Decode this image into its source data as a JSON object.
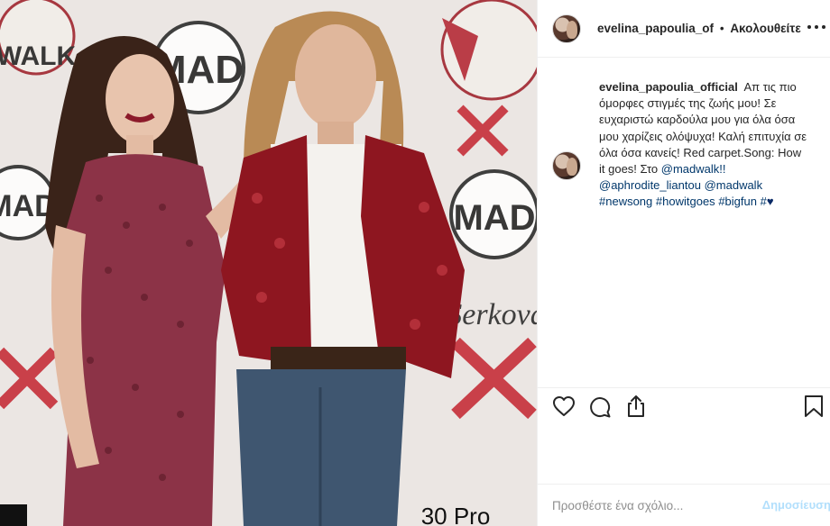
{
  "post": {
    "photo_signs": [
      "MAD",
      "WALK",
      "MAD",
      "MAD",
      "Serkova",
      "30 Pro"
    ]
  },
  "header": {
    "username": "evelina_papoulia_of",
    "separator": "•",
    "follow_label": "Ακολουθείτε",
    "more_icon": "more-horizontal-icon"
  },
  "caption": {
    "username": "evelina_papoulia_official",
    "text": "Απ τις πιο όμορφες στιγμές της ζωής μου! Σε ευχαριστώ καρδούλα μου για όλα όσα μου χαρίζεις ολόψυχα! Καλή επιτυχία σε όλα όσα κανείς! Red carpet.Song: How it goes! Στο",
    "mention_1": "@madwalk!!",
    "mention_2": "@aphrodite_liantou",
    "mention_3": "@madwalk",
    "hashtag_1": "#newsong",
    "hashtag_2": "#howitgoes",
    "hashtag_3": "#bigfun",
    "hashtag_4": "#",
    "heart": "♥"
  },
  "actions": {
    "like_icon": "heart-outline-icon",
    "comment_icon": "speech-bubble-icon",
    "share_icon": "share-icon",
    "save_icon": "bookmark-icon"
  },
  "comment_box": {
    "placeholder": "Προσθέστε ένα σχόλιο...",
    "post_label": "Δημοσίευση"
  },
  "colors": {
    "link": "#00376b",
    "post_disabled": "#b2dffc",
    "border": "#efefef"
  }
}
